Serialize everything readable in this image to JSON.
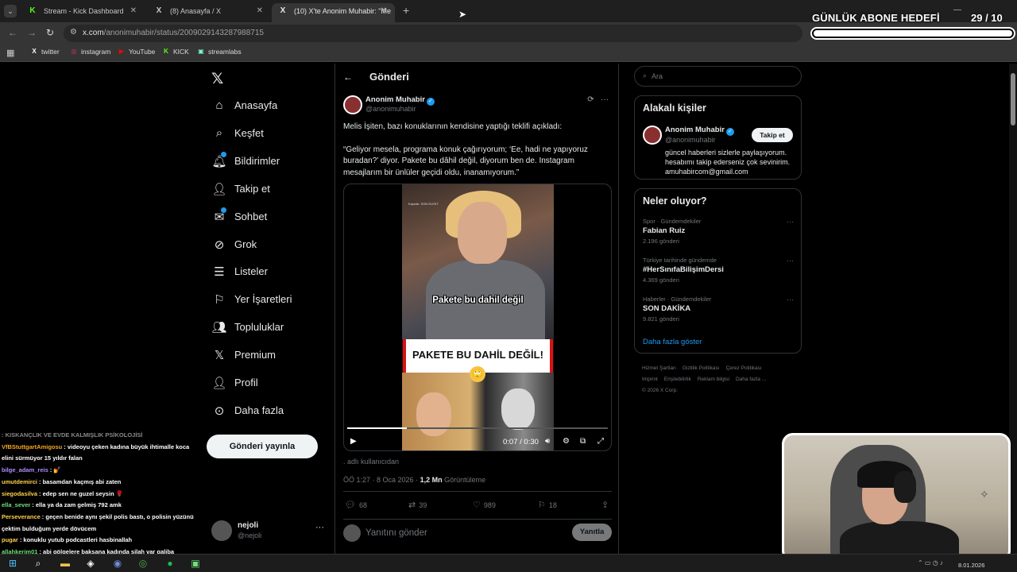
{
  "browser": {
    "tabs": [
      {
        "title": "Stream - Kick Dashboard",
        "favicon": "K",
        "favicon_color": "#53fc18"
      },
      {
        "title": "(8) Anasayfa / X",
        "favicon": "X",
        "favicon_color": "#ffffff"
      },
      {
        "title": "(10) X'te Anonim Muhabir: \"Me",
        "favicon": "X",
        "favicon_color": "#ffffff"
      }
    ],
    "url_domain": "x.com",
    "url_path": "/anonimuhabir/status/2009029143287988715",
    "bookmarks": [
      {
        "label": "twitter",
        "icon": "X",
        "color": "#ffffff"
      },
      {
        "label": "instagram",
        "icon": "◎",
        "color": "#e1306c"
      },
      {
        "label": "YouTube",
        "icon": "▶",
        "color": "#ff0000"
      },
      {
        "label": "KICK",
        "icon": "K",
        "color": "#53fc18"
      },
      {
        "label": "streamlabs",
        "icon": "▣",
        "color": "#80f5d2"
      }
    ]
  },
  "overlay": {
    "goal_title": "GÜNLÜK ABONE HEDEFİ",
    "goal_count": "29  / 10",
    "goal_progress": 1.0
  },
  "nav": {
    "items": [
      {
        "label": "Anasayfa",
        "icon": "home-icon",
        "glyph": "⌂"
      },
      {
        "label": "Keşfet",
        "icon": "search-icon",
        "glyph": "⌕"
      },
      {
        "label": "Bildirimler",
        "icon": "bell-icon",
        "glyph": "🔔︎",
        "dot": true
      },
      {
        "label": "Takip et",
        "icon": "follow-icon",
        "glyph": "👤︎"
      },
      {
        "label": "Sohbet",
        "icon": "mail-icon",
        "glyph": "✉",
        "dot": true
      },
      {
        "label": "Grok",
        "icon": "grok-icon",
        "glyph": "⊘"
      },
      {
        "label": "Listeler",
        "icon": "list-icon",
        "glyph": "☰"
      },
      {
        "label": "Yer İşaretleri",
        "icon": "bookmark-icon",
        "glyph": "⚐"
      },
      {
        "label": "Topluluklar",
        "icon": "community-icon",
        "glyph": "👥︎"
      },
      {
        "label": "Premium",
        "icon": "x-premium-icon",
        "glyph": "𝕏"
      },
      {
        "label": "Profil",
        "icon": "profile-icon",
        "glyph": "👤︎"
      },
      {
        "label": "Daha fazla",
        "icon": "more-circle-icon",
        "glyph": "⊙"
      }
    ],
    "post_button": "Gönderi yayınla",
    "account_name": "nejoli",
    "account_handle": "@nejoli"
  },
  "post": {
    "header_title": "Gönderi",
    "author_name": "Anonim Muhabir",
    "author_handle": "@anonimuhabir",
    "text_p1": "Melis İşiten, bazı konuklarının kendisine yaptığı teklifi açıkladı:",
    "text_p2": "“Geliyor mesela, programa konuk çağırıyorum; ‘Ee, hadi ne yapıyoruz buradan?’ diyor. Pakete bu dâhil değil, diyorum ben de. Instagram mesajlarım bir ünlüler geçidi oldu, inanamıyorum.”",
    "video": {
      "caption_top": "Pakete bu dahil değil",
      "banner": "PAKETE BU DAHİL DEĞİL!",
      "source_tag": "Kaynak: SON ELEKT",
      "time": "0:07 / 0:30",
      "progress": 0.23
    },
    "from_user": ". adlı kullanıcıdan",
    "meta_time": "ÖÖ 1:27 · 8 Oca 2026 · ",
    "meta_views": "1,2 Mn",
    "meta_views_label": " Görüntüleme",
    "stats": {
      "replies": "68",
      "reposts": "39",
      "likes": "989",
      "bookmarks": "18"
    },
    "reply_placeholder": "Yanıtını gönder",
    "reply_button": "Yanıtla"
  },
  "right": {
    "search_placeholder": "Ara",
    "related_title": "Alakalı kişiler",
    "related_name": "Anonim Muhabir",
    "related_handle": "@anonimuhabir",
    "follow_label": "Takip et",
    "related_bio": "güncel haberleri sizlerle paylaşıyorum. hesabımı takip ederseniz çok sevinirim. amuhabircom@gmail.com",
    "trends_title": "Neler oluyor?",
    "trends": [
      {
        "category": "Spor · Gündemdekiler",
        "name": "Fabian Ruiz",
        "count": "2.196 gönderi"
      },
      {
        "category": "Türkiye tarihinde gündemde",
        "name": "#HerSınıfaBilişimDersi",
        "count": "4.369 gönderi"
      },
      {
        "category": "Haberler · Gündemdekiler",
        "name": "SON DAKİKA",
        "count": "9.821 gönderi"
      }
    ],
    "show_more": "Daha fazla göster",
    "footer": [
      "Hizmet Şartları",
      "Gizlilik Politikası",
      "Çerez Politikası",
      "Imprint",
      "Erişilebilirlik",
      "Reklam bilgisi",
      "Daha fazla ...",
      "© 2026 X Corp."
    ]
  },
  "chat": [
    {
      "user": "",
      "msg": ": KISKANÇLIK VE EVDE KALMIŞLIK PSİKOLOJİSİ",
      "color": "#888888",
      "msg_color": "#888888"
    },
    {
      "user": "VfBStuttgartAmigosu",
      "msg": ": videoyu çeken kadına büyük ihtimalle koca",
      "color": "#f5a623",
      "msg_color": "#ffffff"
    },
    {
      "user": "",
      "msg": "elini sürmüyor 15 yıldır falan",
      "color": "#ffffff",
      "msg_color": "#ffffff"
    },
    {
      "user": "bilge_adam_reis",
      "msg": ": 💅",
      "color": "#b28cff",
      "msg_color": "#ffffff"
    },
    {
      "user": "umutdemirci",
      "msg": ": basamdan kaçmış abi zaten",
      "color": "#ffd24a",
      "msg_color": "#ffffff"
    },
    {
      "user": "siegodasilva",
      "msg": ": edep sen ne guzel seysin 🌹",
      "color": "#ffd24a",
      "msg_color": "#ffffff"
    },
    {
      "user": "ella_sever",
      "msg": ": ella ya da zam gelmiş 792 amk",
      "color": "#6ee07a",
      "msg_color": "#ffffff"
    },
    {
      "user": "Perseverance",
      "msg": ": geçen benide aynı şekil polis bastı, o polisin yüzünü",
      "color": "#ffd24a",
      "msg_color": "#ffffff"
    },
    {
      "user": "",
      "msg": "çektim bulduğum yerde dövücem",
      "color": "#ffffff",
      "msg_color": "#ffffff"
    },
    {
      "user": "pugar",
      "msg": ": konuklu yutub podcastleri hasbinallah",
      "color": "#ffd24a",
      "msg_color": "#ffffff"
    },
    {
      "user": "allahkerim01",
      "msg": ": abi gölgelere baksana kadında silah var galiba",
      "color": "#6ee07a",
      "msg_color": "#ffffff"
    }
  ],
  "taskbar": {
    "date": "8.01.2026"
  }
}
